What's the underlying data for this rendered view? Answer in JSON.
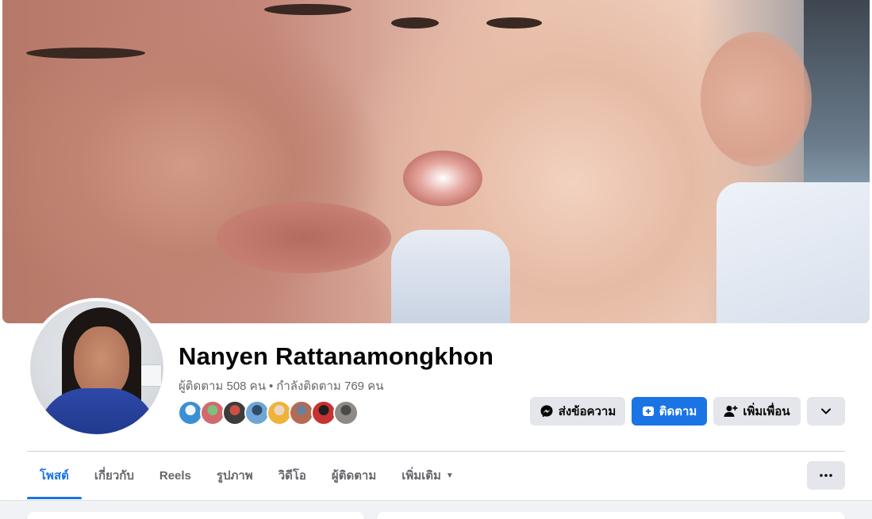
{
  "profile": {
    "name": "Nanyen Rattanamongkhon",
    "followers": "ผู้ติดตาม 508 คน",
    "separator": "•",
    "following": "กำลังติดตาม 769 คน"
  },
  "friends": [
    {
      "color": "#3a8fd6",
      "accent": "#f2f5f8"
    },
    {
      "color": "#d2696e",
      "accent": "#7fc07c"
    },
    {
      "color": "#3c3c3c",
      "accent": "#c9513f"
    },
    {
      "color": "#6fa6d6",
      "accent": "#2e4d6a"
    },
    {
      "color": "#f0b33a",
      "accent": "#e9d6c6"
    },
    {
      "color": "#b56b52",
      "accent": "#6c7f9a"
    },
    {
      "color": "#c73232",
      "accent": "#1f1f1f"
    },
    {
      "color": "#8f8a84",
      "accent": "#4a4a4a"
    }
  ],
  "actions": {
    "message_label": "ส่งข้อความ",
    "follow_label": "ติดตาม",
    "add_friend_label": "เพิ่มเพื่อน"
  },
  "tabs": [
    {
      "label": "โพสต์",
      "active": true
    },
    {
      "label": "เกี่ยวกับ",
      "active": false
    },
    {
      "label": "Reels",
      "active": false
    },
    {
      "label": "รูปภาพ",
      "active": false
    },
    {
      "label": "วิดีโอ",
      "active": false
    },
    {
      "label": "ผู้ติดตาม",
      "active": false
    },
    {
      "label": "เพิ่มเติม",
      "active": false,
      "dropdown": true
    }
  ],
  "icons": {
    "message": "messenger-icon",
    "follow": "follow-icon",
    "add_friend": "add-friend-icon",
    "expand": "chevron-down-icon",
    "more": "more-options-icon",
    "tab_dropdown": "caret-down-icon"
  },
  "colors": {
    "accent": "#1b74e4",
    "secondary_text": "#65676b",
    "button_grey": "#e4e6eb"
  }
}
